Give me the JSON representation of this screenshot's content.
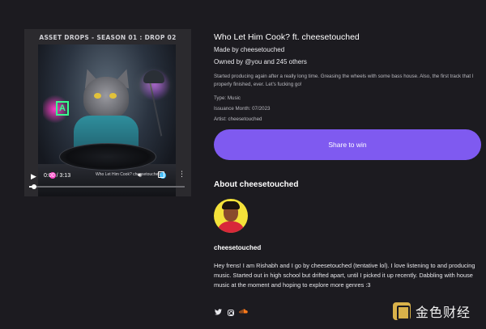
{
  "cover": {
    "header": "ASSET DROPS - SEASON 01 : DROP 02",
    "sign_letter": "A"
  },
  "player": {
    "time": "0:00 / 3:13",
    "caption": "Who Let Him Cook? cheesetouched",
    "progress": 0.03,
    "play_icon": "play-icon",
    "volume_icon": "volume-icon",
    "fullscreen_icon": "fullscreen-icon",
    "more_icon": "more-vertical-icon"
  },
  "track": {
    "title": "Who Let Him Cook? ft. cheesetouched",
    "made_by": "Made by cheesetouched",
    "owned_by": "Owned by @you and 245 others",
    "description": "Started producing again after a really long time. Greasing the wheels with some bass house. Also, the first track that I properly finished, ever. Let's fucking go!",
    "type": "Type: Music",
    "issuance": "Issuance Month: 07/2023",
    "artist": "Artist: cheesetouched"
  },
  "share": {
    "label": "Share to win"
  },
  "about": {
    "heading": "About cheesetouched",
    "name": "cheesetouched",
    "bio": "Hey frens! I am Rishabh and I go by cheesetouched (tentative lol). I love listening to and producing music. Started out in high school but drifted apart, until I picked it up recently. Dabbling with house music at the moment and hoping to explore more genres :3",
    "socials": [
      "twitter-icon",
      "instagram-icon",
      "soundcloud-icon"
    ]
  },
  "watermark": {
    "text": "金色财经"
  },
  "colors": {
    "background": "#1c1b20",
    "accent": "#7f5af0",
    "soundcloud": "#ff7a1a"
  }
}
